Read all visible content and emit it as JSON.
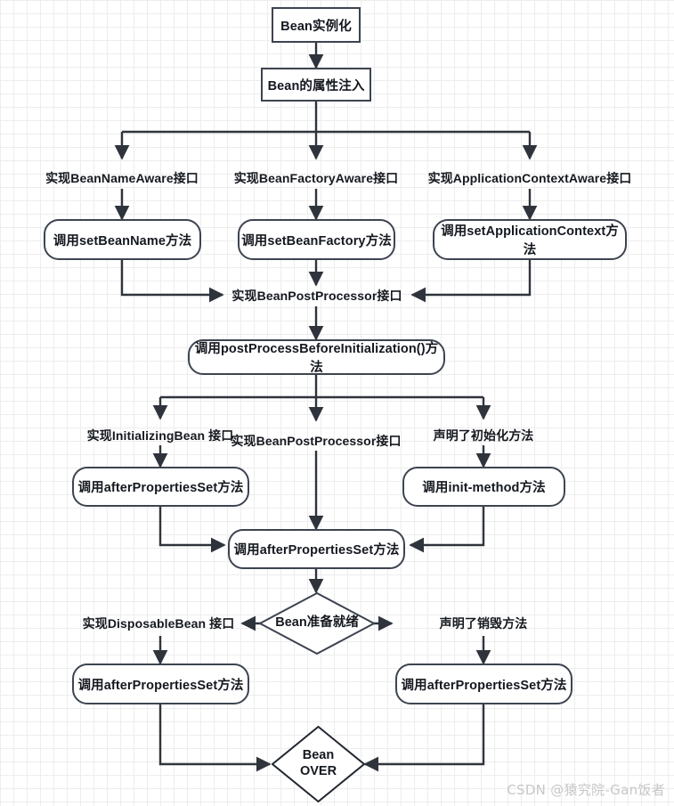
{
  "diagram": {
    "title": "Spring Bean Lifecycle Flowchart",
    "stroke_color": "#3d4450",
    "edge_color": "#2f343c",
    "text_color": "#14181f",
    "background": "#ffffff",
    "grid_color": "#ededed"
  },
  "nodes": {
    "bean_instantiation": "Bean实例化",
    "bean_property_injection": "Bean的属性注入",
    "label_bean_name_aware": "实现BeanNameAware接口",
    "label_bean_factory_aware": "实现BeanFactoryAware接口",
    "label_application_context_aware": "实现ApplicationContextAware接口",
    "call_set_bean_name": "调用setBeanName方法",
    "call_set_bean_factory": "调用setBeanFactory方法",
    "call_set_application_context": "调用setApplicationContext方法",
    "label_bean_post_processor_1": "实现BeanPostProcessor接口",
    "call_post_process_before_initialization": "调用postProcessBeforeInitialization()方法",
    "label_initializing_bean": "实现InitializingBean 接口",
    "label_bean_post_processor_2": "实现BeanPostProcessor接口",
    "label_declared_init_method": "声明了初始化方法",
    "call_after_properties_set_left": "调用afterPropertiesSet方法",
    "call_init_method": "调用init-method方法",
    "call_after_properties_set_merge": "调用afterPropertiesSet方法",
    "decision_bean_ready": "Bean准备就绪",
    "label_disposable_bean": "实现DisposableBean 接口",
    "label_declared_destroy_method": "声明了销毁方法",
    "call_after_properties_set_destroy_left": "调用afterPropertiesSet方法",
    "call_after_properties_set_destroy_right": "调用afterPropertiesSet方法",
    "decision_bean_over": "Bean\nOVER"
  },
  "watermark": {
    "text": "CSDN @猿究院-Gan饭者"
  }
}
